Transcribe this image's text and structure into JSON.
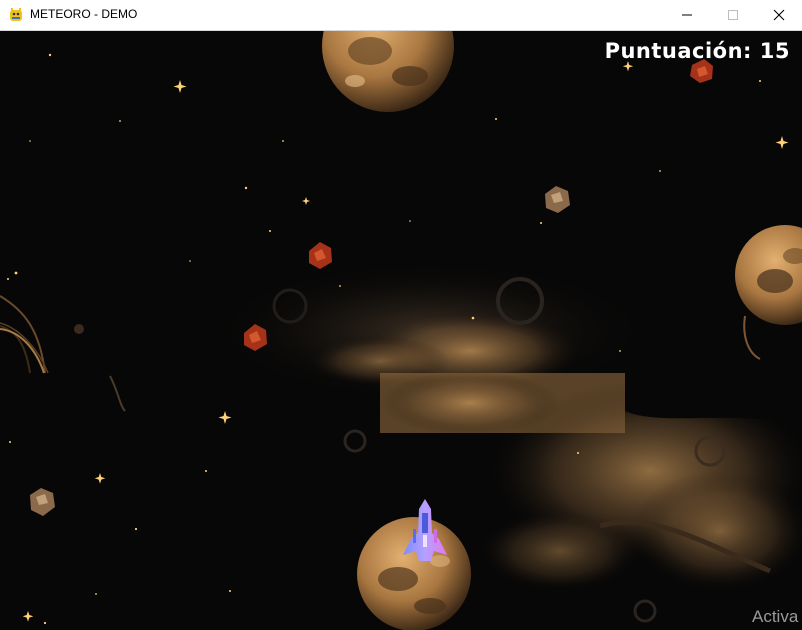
{
  "window": {
    "title": "METEORO - DEMO",
    "icon": "pygame-snake-icon",
    "buttons": {
      "minimize": "minimize-icon",
      "maximize": "maximize-icon",
      "close": "close-icon"
    }
  },
  "hud": {
    "score_label": "Puntuación:",
    "score_value": 15,
    "score_text": "Puntuación: 15"
  },
  "watermark": {
    "text": "Activa"
  },
  "colors": {
    "space": "#070707",
    "planet": "#c9955a",
    "planet_dark": "#5a3e23",
    "meteor_red": "#a7321a",
    "meteor_brown": "#8a6a4a",
    "ship_blue": "#7b8cff",
    "ship_pink": "#e07af0",
    "star": "#ffd27a"
  },
  "entities": {
    "player": "player-ship",
    "meteors": [
      "meteor",
      "meteor",
      "meteor",
      "meteor",
      "meteor",
      "meteor"
    ]
  }
}
